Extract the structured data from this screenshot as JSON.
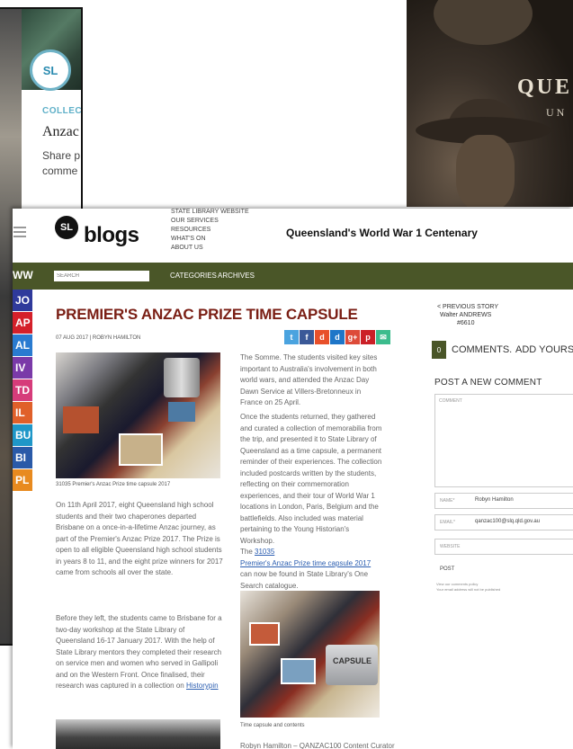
{
  "back_card": {
    "badge": "SL",
    "collection": "COLLECTI",
    "title": "Anzac",
    "share": "Share p comme"
  },
  "back_photo": {
    "title_fragment": "QUE",
    "subtitle_fragment": "UN"
  },
  "blog": {
    "logo_badge": "SL",
    "logo_text": "blogs",
    "top_links": [
      "STATE LIBRARY WEBSITE",
      "OUR SERVICES",
      "RESOURCES",
      "WHAT'S ON",
      "ABOUT US"
    ],
    "site_title": "Queensland's World War 1 Centenary",
    "nav": {
      "ww": "WW",
      "search_placeholder": "SEARCH",
      "categories": "CATEGORIES",
      "archives": "ARCHIVES"
    },
    "side_tabs": [
      {
        "label": "JO",
        "color": "#2f3a9b"
      },
      {
        "label": "AP",
        "color": "#d4202a"
      },
      {
        "label": "AL",
        "color": "#2a7bd0"
      },
      {
        "label": "IV",
        "color": "#7a3aa8"
      },
      {
        "label": "TD",
        "color": "#d63c7a"
      },
      {
        "label": "IL",
        "color": "#e0602a"
      },
      {
        "label": "BU",
        "color": "#1f97c8"
      },
      {
        "label": "BI",
        "color": "#2a5aa8"
      },
      {
        "label": "PL",
        "color": "#e88a1f"
      }
    ],
    "post": {
      "title": "PREMIER'S ANZAC PRIZE TIME CAPSULE",
      "meta": "07 AUG 2017   |   ROBYN HAMILTON",
      "share_icons": [
        {
          "name": "twitter-icon",
          "glyph": "t",
          "color": "#4aa3df"
        },
        {
          "name": "facebook-icon",
          "glyph": "f",
          "color": "#3b5998"
        },
        {
          "name": "delicious-icon",
          "glyph": "d",
          "color": "#e8502a"
        },
        {
          "name": "digg-icon",
          "glyph": "d",
          "color": "#1e76c8"
        },
        {
          "name": "googleplus-icon",
          "glyph": "g+",
          "color": "#dd4b39"
        },
        {
          "name": "pinterest-icon",
          "glyph": "p",
          "color": "#cb2027"
        },
        {
          "name": "email-icon",
          "glyph": "✉",
          "color": "#3cbc8d"
        }
      ],
      "image1_caption": "31035 Premier's Anzac Prize time capsule 2017",
      "para1": "On 11th April 2017, eight Queensland high school students and their two chaperones departed Brisbane on a once-in-a-lifetime Anzac journey, as part of the Premier's Anzac Prize 2017. The Prize is open to all eligible Queensland high school students in years 8 to 11, and the eight prize winners for 2017 came from schools all over the state.",
      "para2": "Before they left, the students came to Brisbane for a two-day workshop at the State Library of Queensland 16-17 January 2017. With the help of State Library mentors they completed their research on service men and women who served in Gallipoli and on the Western Front. Once finalised, their research was captured in a collection on",
      "para2_link": "Historypin",
      "para3": "The Somme. The students visited key sites important to Australia's involvement in both world wars, and attended the Anzac Day Dawn Service at Villers-Bretonneux in France on 25 April.",
      "para4": "Once the students returned, they gathered and curated a collection of memorabilia from the trip, and presented it to State Library of Queensland as a time capsule, a permanent reminder of their experiences. The collection included postcards written by the students, reflecting on their commemoration experiences, and their tour of World War 1 locations in London, Paris, Belgium and the battlefields. Also included was material pertaining to the Young Historian's Workshop.",
      "para5_prefix": "The ",
      "para5_link1": "31035",
      "para5_link2": "Premier's Anzac Prize time capsule 2017",
      "para5_suffix": " can now be found in State Library's One Search catalogue.",
      "image2_label": "CAPSULE",
      "image2_caption": "Time capsule and contents",
      "author_line": "Robyn Hamilton – QANZAC100 Content Curator"
    },
    "sidebar": {
      "prev_label": "< PREVIOUS STORY",
      "prev_title": "Walter ANDREWS",
      "prev_number": "#6610",
      "comments_count": "0",
      "comments_label": "COMMENTS.",
      "add_label": "ADD YOURS",
      "post_new": "POST A NEW COMMENT",
      "comment_placeholder": "COMMENT",
      "name_label": "NAME*",
      "name_value": "Robyn Hamilton",
      "email_label": "EMAIL*",
      "email_value": "qanzac100@slq.qld.gov.au",
      "website_label": "WEBSITE",
      "post_button": "POST",
      "note1": "View our comments policy",
      "note2": "Your email address will not be published"
    }
  }
}
